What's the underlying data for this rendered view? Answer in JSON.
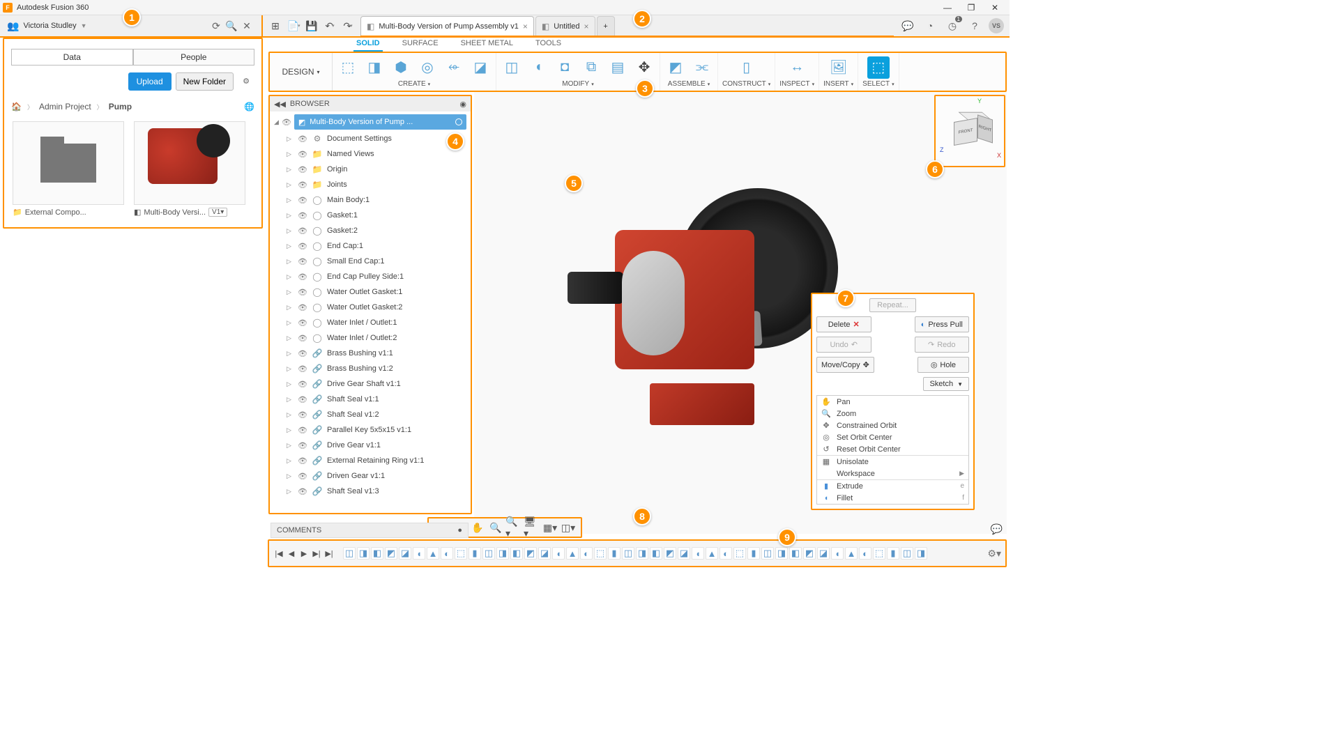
{
  "app": {
    "title": "Autodesk Fusion 360",
    "userName": "Victoria Studley",
    "avatarInitials": "VS",
    "jobCount": "1"
  },
  "windowButtons": {
    "min": "—",
    "max": "❐",
    "close": "✕"
  },
  "tabs": {
    "active": "Multi-Body Version of Pump Assembly v1",
    "second": "Untitled"
  },
  "dataPanel": {
    "tabData": "Data",
    "tabPeople": "People",
    "upload": "Upload",
    "newFolder": "New Folder",
    "breadcrumbProject": "Admin Project",
    "breadcrumbItem": "Pump",
    "folderLabel": "External Compo...",
    "modelLabel": "Multi-Body Versi...",
    "modelVersion": "V1"
  },
  "ribbon": {
    "workspace": "DESIGN",
    "tabs": {
      "solid": "SOLID",
      "surface": "SURFACE",
      "sheetmetal": "SHEET METAL",
      "tools": "TOOLS"
    },
    "groups": {
      "create": "CREATE",
      "modify": "MODIFY",
      "assemble": "ASSEMBLE",
      "construct": "CONSTRUCT",
      "inspect": "INSPECT",
      "insert": "INSERT",
      "select": "SELECT"
    }
  },
  "browser": {
    "title": "BROWSER",
    "root": "Multi-Body Version of Pump ...",
    "items": [
      {
        "label": "Document Settings",
        "icon": "gear"
      },
      {
        "label": "Named Views",
        "icon": "folder"
      },
      {
        "label": "Origin",
        "icon": "folder"
      },
      {
        "label": "Joints",
        "icon": "folder"
      },
      {
        "label": "Main Body:1",
        "icon": "body"
      },
      {
        "label": "Gasket:1",
        "icon": "body"
      },
      {
        "label": "Gasket:2",
        "icon": "body"
      },
      {
        "label": "End Cap:1",
        "icon": "body"
      },
      {
        "label": "Small End Cap:1",
        "icon": "body"
      },
      {
        "label": "End Cap Pulley Side:1",
        "icon": "body"
      },
      {
        "label": "Water Outlet Gasket:1",
        "icon": "body"
      },
      {
        "label": "Water Outlet Gasket:2",
        "icon": "body"
      },
      {
        "label": "Water Inlet / Outlet:1",
        "icon": "body"
      },
      {
        "label": "Water Inlet / Outlet:2",
        "icon": "body"
      },
      {
        "label": "Brass Bushing v1:1",
        "icon": "link"
      },
      {
        "label": "Brass Bushing v1:2",
        "icon": "link"
      },
      {
        "label": "Drive Gear Shaft v1:1",
        "icon": "link"
      },
      {
        "label": "Shaft Seal v1:1",
        "icon": "link"
      },
      {
        "label": "Shaft Seal v1:2",
        "icon": "link"
      },
      {
        "label": "Parallel Key 5x5x15 v1:1",
        "icon": "link"
      },
      {
        "label": "Drive Gear v1:1",
        "icon": "link"
      },
      {
        "label": "External Retaining Ring v1:1",
        "icon": "link"
      },
      {
        "label": "Driven Gear v1:1",
        "icon": "link"
      },
      {
        "label": "Shaft Seal v1:3",
        "icon": "link"
      }
    ]
  },
  "comments": {
    "title": "COMMENTS"
  },
  "viewcube": {
    "front": "FRONT",
    "right": "RIGHT",
    "y": "Y",
    "x": "X",
    "z": "Z"
  },
  "contextMenu": {
    "repeat": "Repeat...",
    "delete": "Delete",
    "pressPull": "Press Pull",
    "undo": "Undo",
    "redo": "Redo",
    "moveCopy": "Move/Copy",
    "hole": "Hole",
    "sketch": "Sketch",
    "items": {
      "pan": "Pan",
      "zoom": "Zoom",
      "constrainedOrbit": "Constrained Orbit",
      "setOrbit": "Set Orbit Center",
      "resetOrbit": "Reset Orbit Center",
      "unisolate": "Unisolate",
      "workspace": "Workspace",
      "extrude": "Extrude",
      "extrudeKey": "e",
      "fillet": "Fillet",
      "filletKey": "f"
    }
  },
  "callouts": {
    "c1": "1",
    "c2": "2",
    "c3": "3",
    "c4": "4",
    "c5": "5",
    "c6": "6",
    "c7": "7",
    "c8": "8",
    "c9": "9"
  }
}
